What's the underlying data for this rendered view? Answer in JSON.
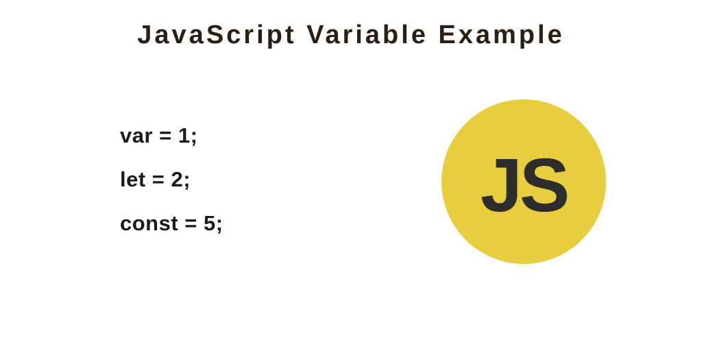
{
  "title": "JavaScript Variable Example",
  "code": {
    "lines": [
      "var = 1;",
      "let = 2;",
      "const = 5;"
    ]
  },
  "badge": {
    "label": "JS",
    "color": "#e8ce3e",
    "text_color": "#2d2d2d"
  }
}
